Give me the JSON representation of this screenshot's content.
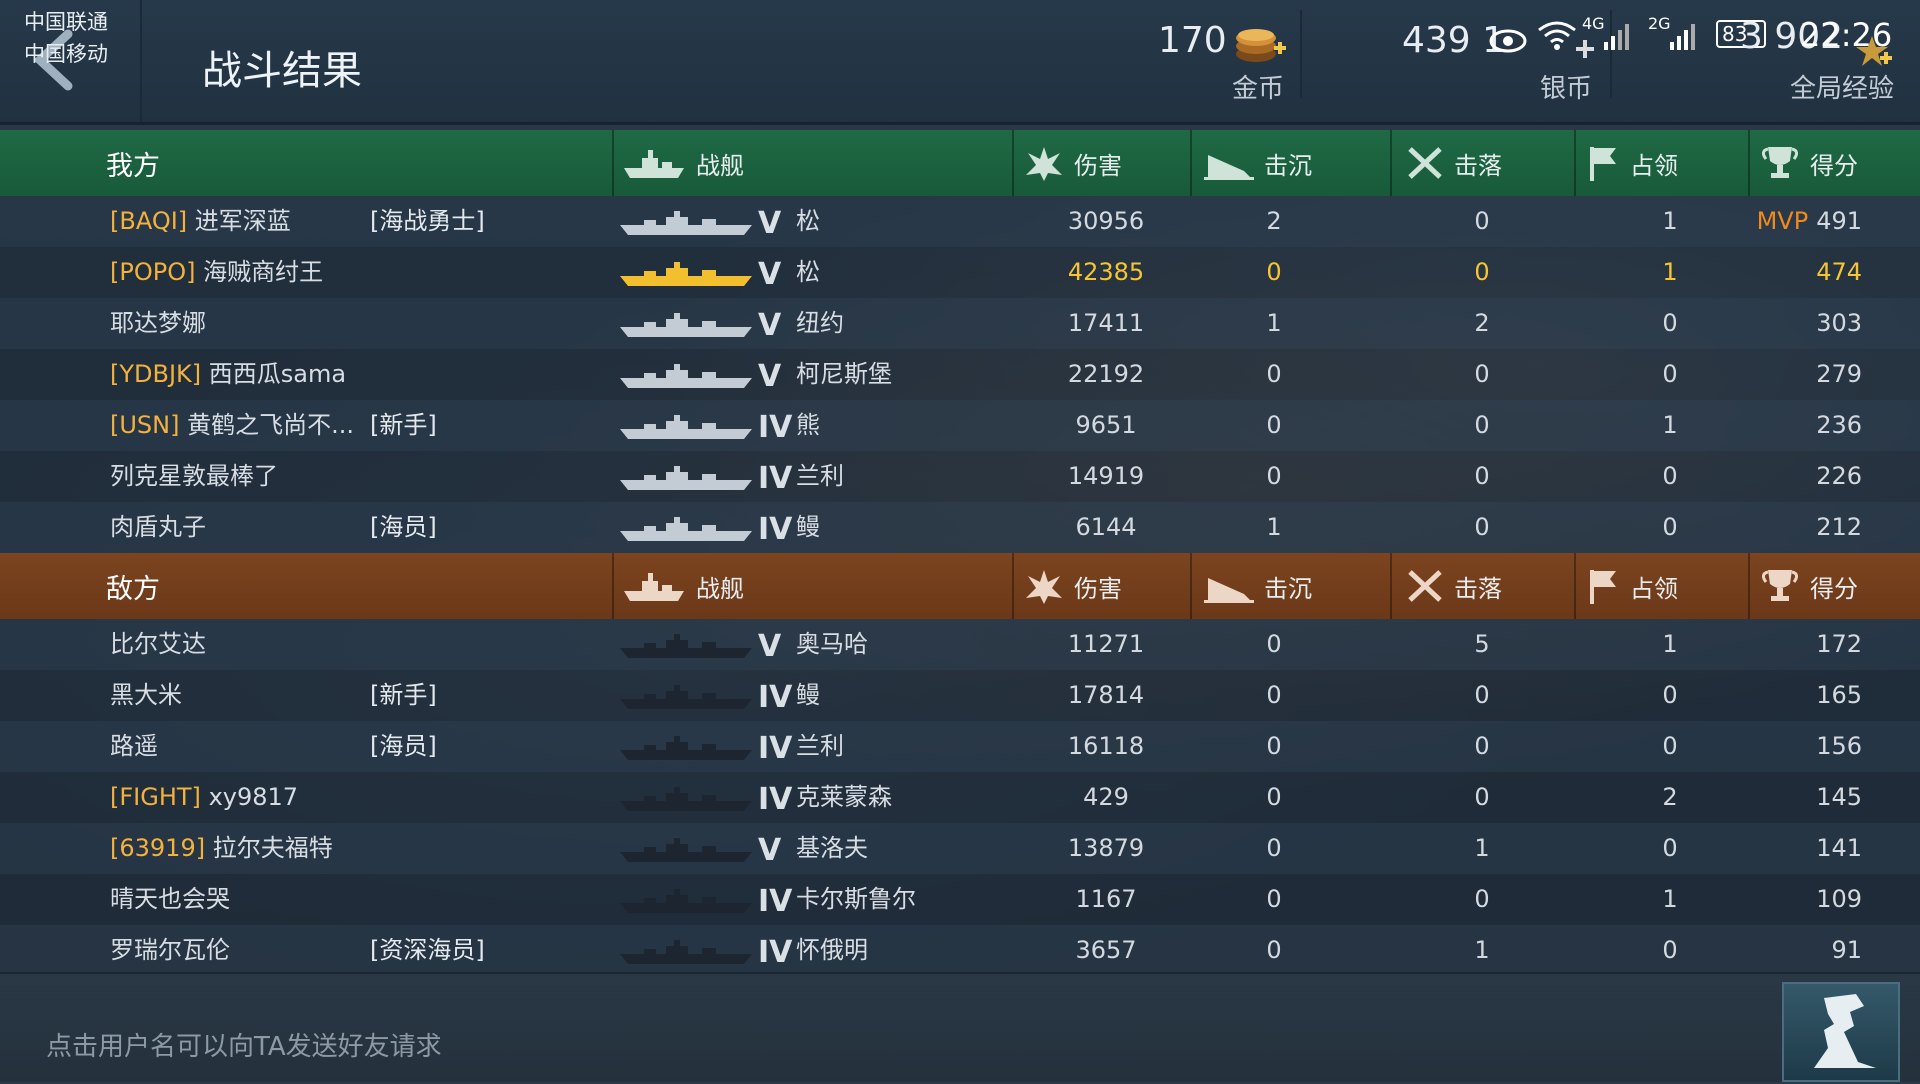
{
  "status_bar": {
    "carriers": [
      "中国联通",
      "中国移动"
    ],
    "net1": "4G",
    "net2": "2G",
    "battery": "83",
    "time": "22:26"
  },
  "header": {
    "title": "战斗结果",
    "gold": {
      "value": "170",
      "label": "金币"
    },
    "silver": {
      "value": "439 1",
      "label": "银币"
    },
    "exp": {
      "value": "3 902",
      "label": "全局经验"
    }
  },
  "columns": {
    "ship": "战舰",
    "damage": "伤害",
    "sunk": "击沉",
    "downed": "击落",
    "capture": "占领",
    "score": "得分"
  },
  "ally": {
    "label": "我方",
    "rows": [
      {
        "tag": "[BAQI]",
        "name": "进军深蓝",
        "title": "[海战勇士]",
        "tier": "V",
        "ship": "松",
        "damage": "30956",
        "sunk": "2",
        "downed": "0",
        "capture": "1",
        "mvp": "MVP",
        "score": "491"
      },
      {
        "tag": "[POPO]",
        "name": "海贼商纣王",
        "title": "",
        "tier": "V",
        "ship": "松",
        "damage": "42385",
        "sunk": "0",
        "downed": "0",
        "capture": "1",
        "mvp": "",
        "score": "474",
        "me": true
      },
      {
        "tag": "",
        "name": "耶达梦娜",
        "title": "",
        "tier": "V",
        "ship": "纽约",
        "damage": "17411",
        "sunk": "1",
        "downed": "2",
        "capture": "0",
        "mvp": "",
        "score": "303"
      },
      {
        "tag": "[YDBJK]",
        "name": "西西瓜sama",
        "title": "",
        "tier": "V",
        "ship": "柯尼斯堡",
        "damage": "22192",
        "sunk": "0",
        "downed": "0",
        "capture": "0",
        "mvp": "",
        "score": "279"
      },
      {
        "tag": "[USN]",
        "name": "黄鹤之飞尚不...",
        "title": "[新手]",
        "tier": "IV",
        "ship": "熊",
        "damage": "9651",
        "sunk": "0",
        "downed": "0",
        "capture": "1",
        "mvp": "",
        "score": "236"
      },
      {
        "tag": "",
        "name": "列克星敦最棒了",
        "title": "",
        "tier": "IV",
        "ship": "兰利",
        "damage": "14919",
        "sunk": "0",
        "downed": "0",
        "capture": "0",
        "mvp": "",
        "score": "226"
      },
      {
        "tag": "",
        "name": "肉盾丸子",
        "title": "[海员]",
        "tier": "IV",
        "ship": "鳗",
        "damage": "6144",
        "sunk": "1",
        "downed": "0",
        "capture": "0",
        "mvp": "",
        "score": "212"
      }
    ]
  },
  "enemy": {
    "label": "敌方",
    "rows": [
      {
        "tag": "",
        "name": "比尔艾达",
        "title": "",
        "tier": "V",
        "ship": "奥马哈",
        "damage": "11271",
        "sunk": "0",
        "downed": "5",
        "capture": "1",
        "mvp": "",
        "score": "172"
      },
      {
        "tag": "",
        "name": "黑大米",
        "title": "[新手]",
        "tier": "IV",
        "ship": "鳗",
        "damage": "17814",
        "sunk": "0",
        "downed": "0",
        "capture": "0",
        "mvp": "",
        "score": "165"
      },
      {
        "tag": "",
        "name": "路遥",
        "title": "[海员]",
        "tier": "IV",
        "ship": "兰利",
        "damage": "16118",
        "sunk": "0",
        "downed": "0",
        "capture": "0",
        "mvp": "",
        "score": "156"
      },
      {
        "tag": "[FIGHT]",
        "name": "xy9817",
        "title": "",
        "tier": "IV",
        "ship": "克莱蒙森",
        "damage": "429",
        "sunk": "0",
        "downed": "0",
        "capture": "2",
        "mvp": "",
        "score": "145"
      },
      {
        "tag": "[63919]",
        "name": "拉尔夫福特",
        "title": "",
        "tier": "V",
        "ship": "基洛夫",
        "damage": "13879",
        "sunk": "0",
        "downed": "1",
        "capture": "0",
        "mvp": "",
        "score": "141"
      },
      {
        "tag": "",
        "name": "晴天也会哭",
        "title": "",
        "tier": "IV",
        "ship": "卡尔斯鲁尔",
        "damage": "1167",
        "sunk": "0",
        "downed": "0",
        "capture": "1",
        "mvp": "",
        "score": "109"
      },
      {
        "tag": "",
        "name": "罗瑞尔瓦伦",
        "title": "[资深海员]",
        "tier": "IV",
        "ship": "怀俄明",
        "damage": "3657",
        "sunk": "0",
        "downed": "1",
        "capture": "0",
        "mvp": "",
        "score": "91"
      }
    ]
  },
  "footer": {
    "hint": "点击用户名可以向TA发送好友请求"
  },
  "colors": {
    "ally_header": "#1f6a45",
    "enemy_header": "#7c4420",
    "clan_tag": "#f3b23c",
    "me_highlight": "#f6c531",
    "mvp": "#f08a1c"
  }
}
